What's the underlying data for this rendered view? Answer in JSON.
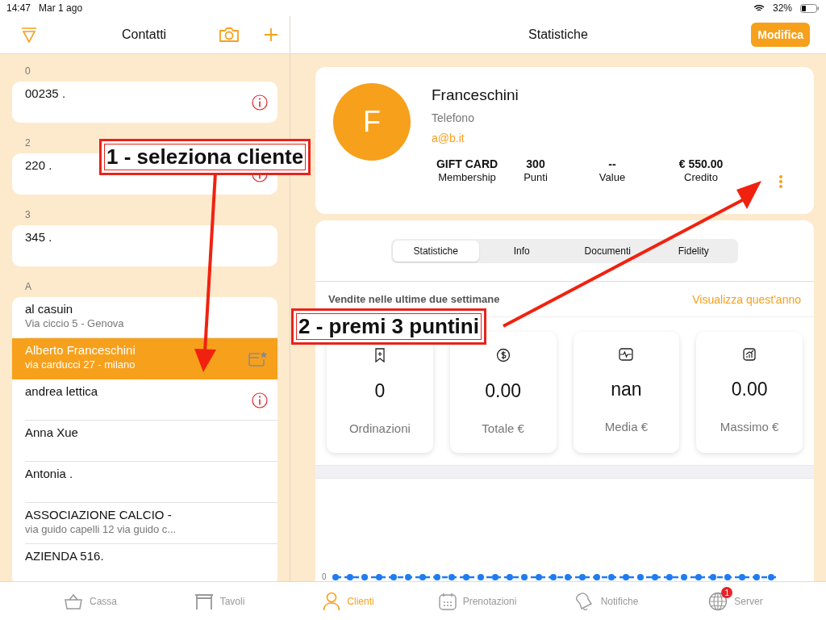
{
  "status_bar": {
    "time": "14:47",
    "date": "Mar 1 ago",
    "battery": "32%"
  },
  "contacts": {
    "title": "Contatti",
    "sections": [
      {
        "label": "0",
        "items": [
          {
            "name": "00235 .",
            "alert": true,
            "selected": false
          }
        ]
      },
      {
        "label": "2",
        "items": [
          {
            "name": "220 .",
            "alert": true,
            "selected": false
          }
        ]
      },
      {
        "label": "3",
        "items": [
          {
            "name": "345 .",
            "alert": false,
            "selected": false
          }
        ]
      },
      {
        "label": "A",
        "items": [
          {
            "name": "al casuin",
            "address": "Via ciccio 5 - Genova",
            "alert": false,
            "selected": false
          },
          {
            "name": "Alberto Franceschini",
            "address": "via carducci  27 - milano",
            "alert": false,
            "selected": true
          },
          {
            "name": "andrea lettica",
            "alert": true,
            "selected": false
          },
          {
            "name": "Anna Xue",
            "alert": false,
            "selected": false
          },
          {
            "name": "Antonia .",
            "alert": false,
            "selected": false
          },
          {
            "name": "ASSOCIAZIONE CALCIO -",
            "address": "via guido capelli 12 via guido c...",
            "alert": false,
            "selected": false
          },
          {
            "name": "AZIENDA 516.",
            "alert": false,
            "selected": false
          }
        ]
      }
    ]
  },
  "detail": {
    "title": "Statistiche",
    "edit_button": "Modifica",
    "profile": {
      "initial": "F",
      "name": "Franceschini",
      "phone": "Telefono",
      "email": "a@b.it",
      "stats": [
        {
          "value": "GIFT CARD",
          "label": "Membership"
        },
        {
          "value": "300",
          "label": "Punti"
        },
        {
          "value": "--",
          "label": "Value"
        },
        {
          "value": "€ 550.00",
          "label": "Credito"
        }
      ]
    },
    "segments": [
      {
        "label": "Statistiche",
        "selected": true
      },
      {
        "label": "Info",
        "selected": false
      },
      {
        "label": "Documenti",
        "selected": false
      },
      {
        "label": "Fidelity",
        "selected": false
      }
    ],
    "period_heading": "Vendite nelle ultime due settimane",
    "period_link": "Visualizza quest'anno",
    "tiles": [
      {
        "value": "0",
        "label": "Ordinazioni"
      },
      {
        "value": "0.00",
        "label": "Totale €"
      },
      {
        "value": "nan",
        "label": "Media €"
      },
      {
        "value": "0.00",
        "label": "Massimo €"
      }
    ],
    "chart_axis_label": "0"
  },
  "tab_bar": [
    {
      "label": "Cassa",
      "selected": false
    },
    {
      "label": "Tavoli",
      "selected": false
    },
    {
      "label": "Clienti",
      "selected": true
    },
    {
      "label": "Prenotazioni",
      "selected": false
    },
    {
      "label": "Notifiche",
      "selected": false
    },
    {
      "label": "Server",
      "selected": false,
      "badge": "1"
    }
  ],
  "annotations": [
    {
      "text": "1 - seleziona cliente"
    },
    {
      "text": "2 - premi 3 puntini"
    }
  ]
}
